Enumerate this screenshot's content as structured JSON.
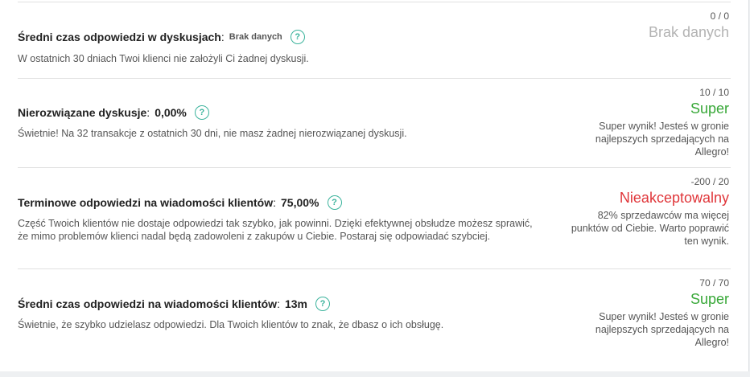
{
  "rows": [
    {
      "name": "Średni czas odpowiedzi w dyskusjach",
      "value": "Brak danych",
      "description": "W ostatnich 30 dniach Twoi klienci nie założyli Ci żadnej dyskusji.",
      "score": "0 / 0",
      "status": "Brak danych",
      "status_color": "#b3b3b3",
      "note": ""
    },
    {
      "name": "Nierozwiązane dyskusje",
      "value": "0,00%",
      "description": "Świetnie! Na 32 transakcje z ostatnich 30 dni, nie masz żadnej nierozwiązanej dyskusji.",
      "score": "10 / 10",
      "status": "Super",
      "status_color": "#38a838",
      "note": "Super wynik! Jesteś w gronie najlepszych sprzedających na Allegro!"
    },
    {
      "name": "Terminowe odpowiedzi na wiadomości klientów",
      "value": "75,00%",
      "description": "Część Twoich klientów nie dostaje odpowiedzi tak szybko, jak powinni. Dzięki efektywnej obsłudze możesz sprawić, że mimo problemów klienci nadal będą zadowoleni z zakupów u Ciebie. Postaraj się odpowiadać szybciej.",
      "score": "-200 / 20",
      "status": "Nieakceptowalny",
      "status_color": "#e0363a",
      "note": "82% sprzedawców ma więcej punktów od Ciebie. Warto poprawić ten wynik."
    },
    {
      "name": "Średni czas odpowiedzi na wiadomości klientów",
      "value": "13m",
      "description": "Świetnie, że szybko udzielasz odpowiedzi. Dla Twoich klientów to znak, że dbasz o ich obsługę.",
      "score": "70 / 70",
      "status": "Super",
      "status_color": "#38a838",
      "note": "Super wynik! Jesteś w gronie najlepszych sprzedających na Allegro!"
    }
  ],
  "icons": {
    "help": "question-mark-circle-icon",
    "help_glyph": "?"
  }
}
